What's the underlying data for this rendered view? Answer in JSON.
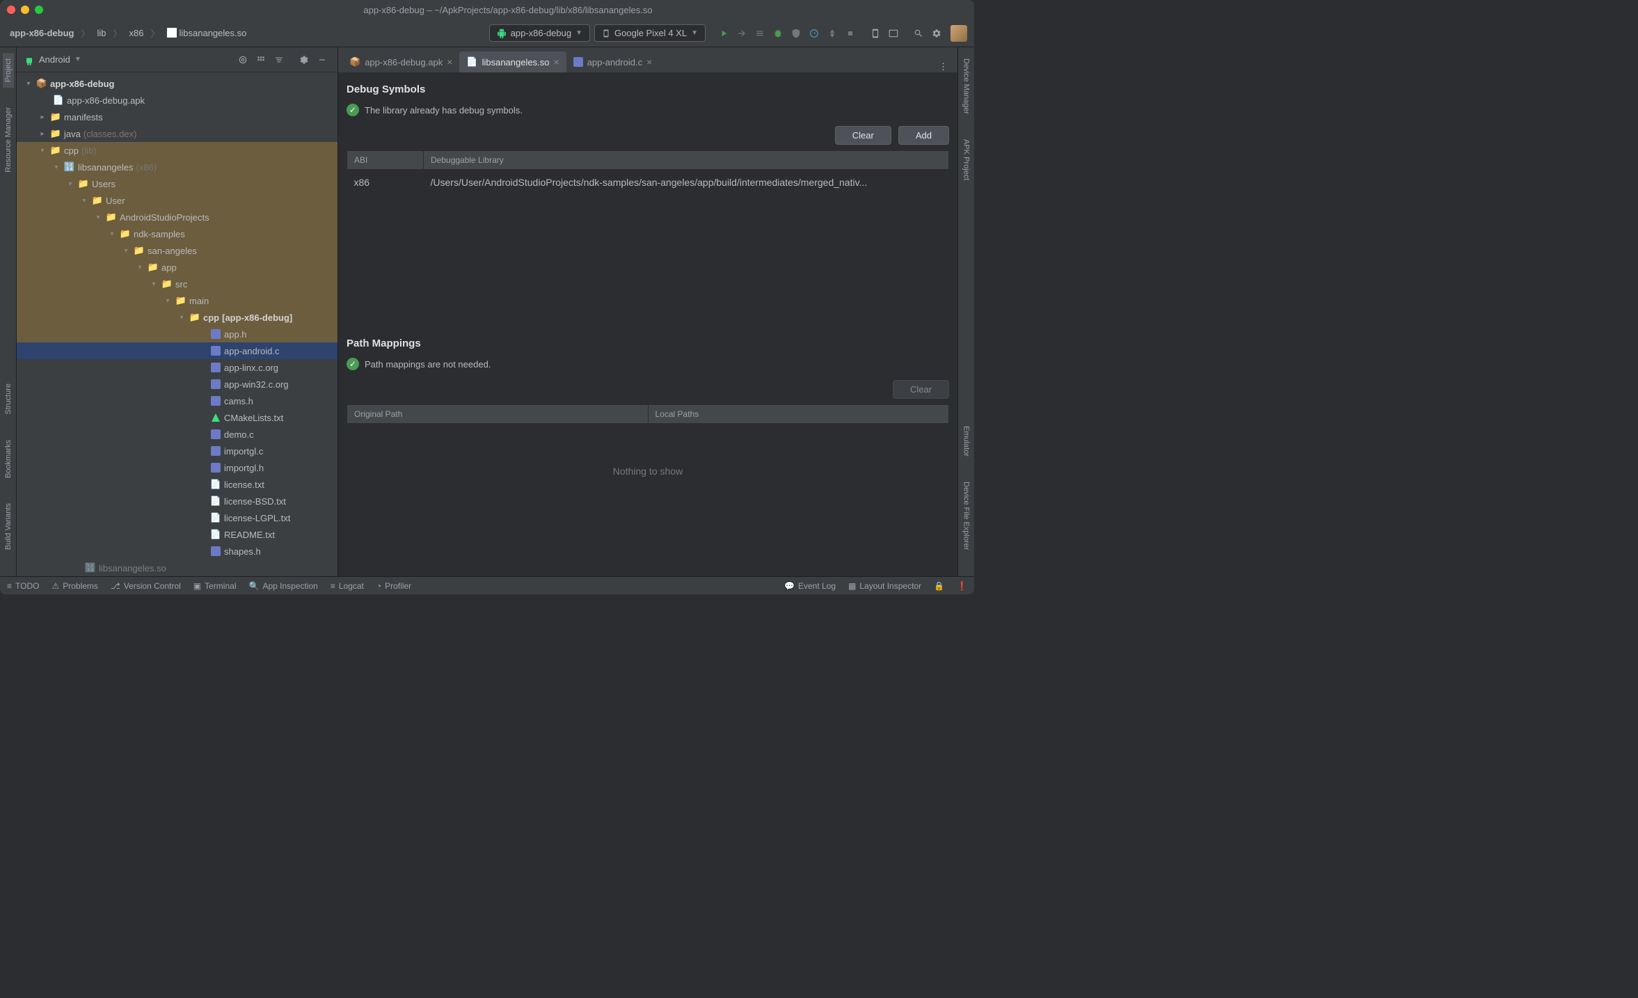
{
  "window": {
    "title": "app-x86-debug – ~/ApkProjects/app-x86-debug/lib/x86/libsanangeles.so"
  },
  "breadcrumb": {
    "items": [
      "app-x86-debug",
      "lib",
      "x86",
      "libsanangeles.so"
    ]
  },
  "toolbar": {
    "config_label": "app-x86-debug",
    "device_label": "Google Pixel 4 XL"
  },
  "project_panel": {
    "dropdown_label": "Android"
  },
  "tree": {
    "n0": {
      "label": "app-x86-debug"
    },
    "n1": {
      "label": "app-x86-debug.apk"
    },
    "n2": {
      "label": "manifests"
    },
    "n3": {
      "label": "java",
      "suffix": "(classes.dex)"
    },
    "n4": {
      "label": "cpp",
      "suffix": "(lib)"
    },
    "n5": {
      "label": "libsanangeles",
      "suffix": "(x86)"
    },
    "n6": {
      "label": "Users"
    },
    "n7": {
      "label": "User"
    },
    "n8": {
      "label": "AndroidStudioProjects"
    },
    "n9": {
      "label": "ndk-samples"
    },
    "n10": {
      "label": "san-angeles"
    },
    "n11": {
      "label": "app"
    },
    "n12": {
      "label": "src"
    },
    "n13": {
      "label": "main"
    },
    "n14": {
      "label": "cpp",
      "suffix": "[app-x86-debug]"
    },
    "n15": {
      "label": "app.h"
    },
    "n16": {
      "label": "app-android.c"
    },
    "n17": {
      "label": "app-linx.c.org"
    },
    "n18": {
      "label": "app-win32.c.org"
    },
    "n19": {
      "label": "cams.h"
    },
    "n20": {
      "label": "CMakeLists.txt"
    },
    "n21": {
      "label": "demo.c"
    },
    "n22": {
      "label": "importgl.c"
    },
    "n23": {
      "label": "importgl.h"
    },
    "n24": {
      "label": "license.txt"
    },
    "n25": {
      "label": "license-BSD.txt"
    },
    "n26": {
      "label": "license-LGPL.txt"
    },
    "n27": {
      "label": "README.txt"
    },
    "n28": {
      "label": "shapes.h"
    },
    "n29": {
      "label": "libsanangeles.so"
    }
  },
  "tabs": {
    "t0": "app-x86-debug.apk",
    "t1": "libsanangeles.so",
    "t2": "app-android.c"
  },
  "debug_symbols": {
    "title": "Debug Symbols",
    "status": "The library already has debug symbols.",
    "clear_label": "Clear",
    "add_label": "Add",
    "col_abi": "ABI",
    "col_lib": "Debuggable Library",
    "row_abi": "x86",
    "row_lib": "/Users/User/AndroidStudioProjects/ndk-samples/san-angeles/app/build/intermediates/merged_nativ..."
  },
  "path_mappings": {
    "title": "Path Mappings",
    "status": "Path mappings are not needed.",
    "clear_label": "Clear",
    "col_original": "Original Path",
    "col_local": "Local Paths",
    "empty": "Nothing to show"
  },
  "statusbar": {
    "todo": "TODO",
    "problems": "Problems",
    "vcs": "Version Control",
    "terminal": "Terminal",
    "app_inspection": "App Inspection",
    "logcat": "Logcat",
    "profiler": "Profiler",
    "event_log": "Event Log",
    "layout_inspector": "Layout Inspector"
  },
  "left_gutter": {
    "project": "Project",
    "resource_manager": "Resource Manager",
    "structure": "Structure",
    "bookmarks": "Bookmarks",
    "build_variants": "Build Variants"
  },
  "right_gutter": {
    "device_manager": "Device Manager",
    "apk_project": "APK Project",
    "emulator": "Emulator",
    "device_file_explorer": "Device File Explorer"
  }
}
